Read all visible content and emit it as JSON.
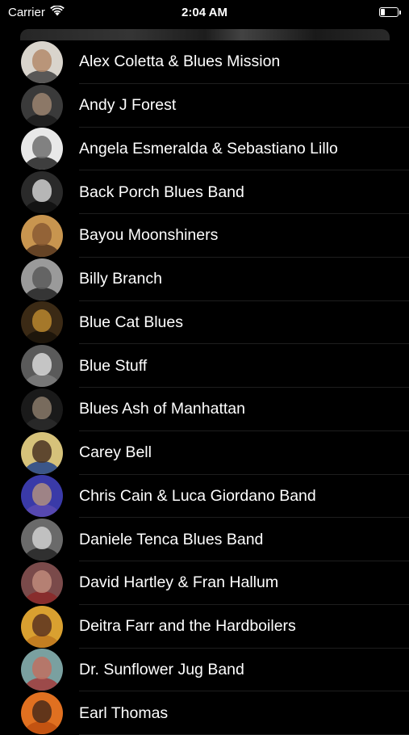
{
  "status_bar": {
    "carrier": "Carrier",
    "time": "2:04 AM",
    "battery_level": 0.3
  },
  "artists": [
    {
      "name": "Alex Coletta & Blues Mission",
      "avatar": {
        "bg": "#d9d4cc",
        "face": "#b38a6a",
        "body": "#4a4a4a"
      }
    },
    {
      "name": "Andy J Forest",
      "avatar": {
        "bg": "#3a3a3a",
        "face": "#9b8470",
        "body": "#1e1e1e"
      }
    },
    {
      "name": "Angela Esmeralda & Sebastiano Lillo",
      "avatar": {
        "bg": "#e8e8e8",
        "face": "#6e6e6e",
        "body": "#2b2b2b"
      }
    },
    {
      "name": "Back Porch Blues Band",
      "avatar": {
        "bg": "#2a2a2a",
        "face": "#cfcfcf",
        "body": "#111111"
      }
    },
    {
      "name": "Bayou Moonshiners",
      "avatar": {
        "bg": "#c8954f",
        "face": "#8a5a33",
        "body": "#5a3a20"
      }
    },
    {
      "name": "Billy Branch",
      "avatar": {
        "bg": "#9a9a9a",
        "face": "#5a5a5a",
        "body": "#2a2a2a"
      }
    },
    {
      "name": "Blue Cat Blues",
      "avatar": {
        "bg": "#3b2a15",
        "face": "#b8862e",
        "body": "#1c140a"
      }
    },
    {
      "name": "Blue Stuff",
      "avatar": {
        "bg": "#5a5a5a",
        "face": "#d8d8d8",
        "body": "#7a7a7a"
      }
    },
    {
      "name": "Blues Ash of Manhattan",
      "avatar": {
        "bg": "#1a1a1a",
        "face": "#8a7a6a",
        "body": "#2a2a2a"
      }
    },
    {
      "name": "Carey Bell",
      "avatar": {
        "bg": "#d6c27a",
        "face": "#4a3222",
        "body": "#2a4a8a"
      }
    },
    {
      "name": "Chris Cain & Luca Giordano Band",
      "avatar": {
        "bg": "#3a3aa8",
        "face": "#b09080",
        "body": "#5a4ab0"
      }
    },
    {
      "name": "Daniele Tenca Blues Band",
      "avatar": {
        "bg": "#6a6a6a",
        "face": "#cfcfcf",
        "body": "#2a2a2a"
      }
    },
    {
      "name": "David Hartley & Fran Hallum",
      "avatar": {
        "bg": "#7a4a4a",
        "face": "#c08a7a",
        "body": "#8a2a2a"
      }
    },
    {
      "name": "Deitra Farr and the Hardboilers",
      "avatar": {
        "bg": "#d9a030",
        "face": "#5a3220",
        "body": "#c07a20"
      }
    },
    {
      "name": "Dr. Sunflower Jug Band",
      "avatar": {
        "bg": "#7aa0a0",
        "face": "#c07060",
        "body": "#a04040"
      }
    },
    {
      "name": "Earl Thomas",
      "avatar": {
        "bg": "#e07020",
        "face": "#4a2a1a",
        "body": "#c05010"
      }
    }
  ]
}
